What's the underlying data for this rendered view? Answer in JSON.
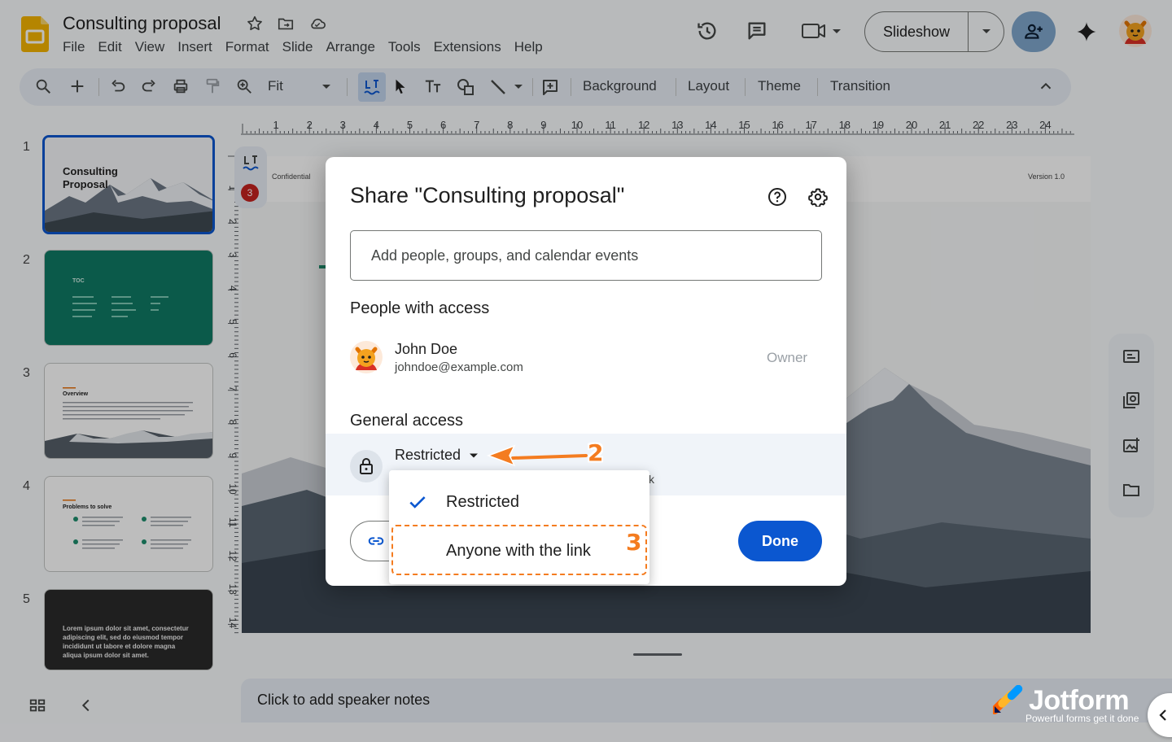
{
  "app": {
    "doc_title": "Consulting proposal",
    "menu": [
      "File",
      "Edit",
      "View",
      "Insert",
      "Format",
      "Slide",
      "Arrange",
      "Tools",
      "Extensions",
      "Help"
    ],
    "slideshow_label": "Slideshow"
  },
  "toolbar": {
    "zoom_label": "Fit",
    "background_label": "Background",
    "layout_label": "Layout",
    "theme_label": "Theme",
    "transition_label": "Transition"
  },
  "filmstrip": {
    "slides": [
      {
        "number": "1",
        "title": "Consulting Proposal",
        "theme": "mountain"
      },
      {
        "number": "2",
        "title": "TOC",
        "theme": "teal"
      },
      {
        "number": "3",
        "title": "Overview",
        "theme": "white"
      },
      {
        "number": "4",
        "title": "Problems to solve",
        "theme": "white"
      },
      {
        "number": "5",
        "title": "Lorem ipsum dolor sit amet, consectetur adipiscing elit, sed do eiusmod tempor incididunt ut labore et dolore magna aliqua ipsum dolor sit amet.",
        "theme": "dark"
      }
    ]
  },
  "canvas": {
    "header_left": "Confidential",
    "header_right": "Version 1.0",
    "ruler_marks": [
      "1",
      "2",
      "3",
      "4",
      "5",
      "6",
      "7",
      "8",
      "9",
      "10",
      "11",
      "12",
      "13",
      "14",
      "15",
      "16",
      "17",
      "18",
      "19",
      "20",
      "21",
      "22",
      "23",
      "24"
    ],
    "ruler_v_marks": [
      "1",
      "2",
      "3",
      "4",
      "5",
      "6",
      "7",
      "8",
      "9",
      "10",
      "11",
      "12",
      "13",
      "14"
    ],
    "comment_count": "3"
  },
  "notes": {
    "placeholder": "Click to add speaker notes"
  },
  "dialog": {
    "title": "Share \"Consulting proposal\"",
    "add_placeholder": "Add people, groups, and calendar events",
    "people_heading": "People with access",
    "person": {
      "name": "John Doe",
      "email": "johndoe@example.com",
      "role": "Owner"
    },
    "general_heading": "General access",
    "access_value": "Restricted",
    "access_sub_fragment": "k",
    "done_label": "Done"
  },
  "dropdown": {
    "options": [
      {
        "label": "Restricted",
        "selected": true
      },
      {
        "label": "Anyone with the link",
        "selected": false
      }
    ]
  },
  "annotations": {
    "step2": "2",
    "step3": "3",
    "accent_color": "#f47c20"
  },
  "watermark": {
    "name": "Jotform",
    "tagline": "Powerful forms get it done"
  },
  "colors": {
    "primary": "#0b57d0",
    "teal_slide": "#0f7a64",
    "dark_slide": "#2b2b2b"
  }
}
